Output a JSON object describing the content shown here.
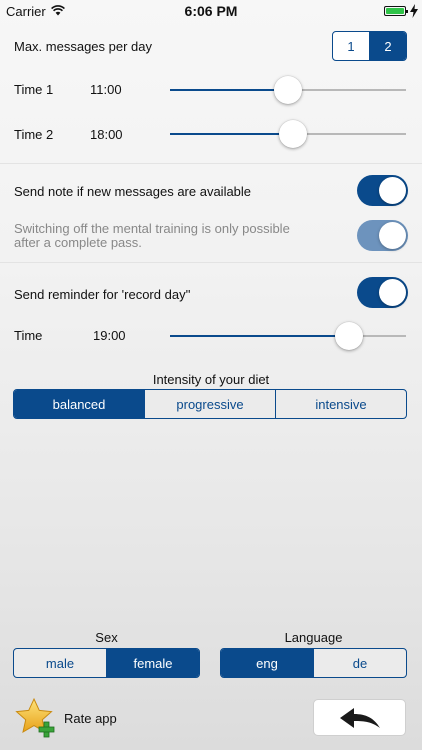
{
  "status_bar": {
    "carrier": "Carrier",
    "time": "6:06 PM",
    "wifi_icon": "wifi-icon",
    "battery_icon": "battery-icon"
  },
  "max_messages": {
    "label": "Max. messages per day",
    "options": [
      "1",
      "2"
    ],
    "selected": "2"
  },
  "time1": {
    "label": "Time 1",
    "value": "11:00",
    "slider_fraction": 0.5
  },
  "time2": {
    "label": "Time 2",
    "value": "18:00",
    "slider_fraction": 0.52
  },
  "send_note": {
    "label": "Send note if new messages are available",
    "on": true
  },
  "mental_training": {
    "label_line1": "Switching off the mental training is only possible",
    "label_line2": "after a complete pass.",
    "on": true,
    "enabled": false
  },
  "reminder": {
    "label": "Send reminder for 'record day''",
    "on": true
  },
  "reminder_time": {
    "label": "Time",
    "value": "19:00",
    "slider_fraction": 0.76
  },
  "diet": {
    "title": "Intensity of your diet",
    "options": [
      "balanced",
      "progressive",
      "intensive"
    ],
    "selected": "balanced"
  },
  "sex": {
    "title": "Sex",
    "options": [
      "male",
      "female"
    ],
    "selected": "female"
  },
  "language": {
    "title": "Language",
    "options": [
      "eng",
      "de"
    ],
    "selected": "eng"
  },
  "rate": {
    "label": "Rate app",
    "icon": "star-plus-icon"
  },
  "back": {
    "icon": "back-arrow-icon"
  },
  "colors": {
    "accent": "#0a4a8c",
    "accent_disabled": "#6d93bd",
    "battery": "#2fc348"
  }
}
